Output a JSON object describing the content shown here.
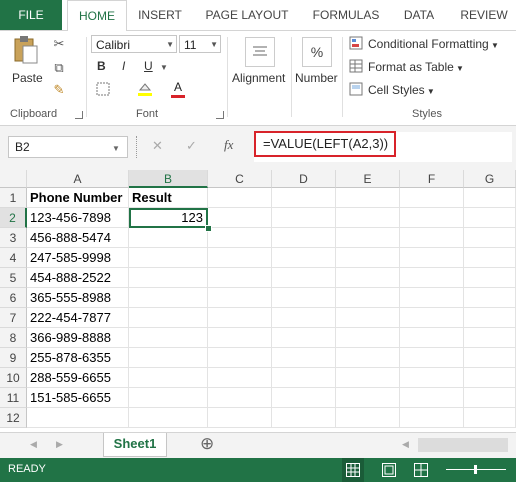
{
  "tabs": [
    "FILE",
    "HOME",
    "INSERT",
    "PAGE LAYOUT",
    "FORMULAS",
    "DATA",
    "REVIEW"
  ],
  "ribbon": {
    "clipboard": {
      "paste": "Paste",
      "label": "Clipboard"
    },
    "font": {
      "name": "Calibri",
      "size": "11",
      "bold": "B",
      "italic": "I",
      "underline": "U",
      "font_color_letter": "A",
      "label": "Font"
    },
    "alignment": {
      "label": "Alignment"
    },
    "number": {
      "label": "Number",
      "symbol": "%"
    },
    "styles": {
      "conditional": "Conditional Formatting",
      "format_table": "Format as Table",
      "cell_styles": "Cell Styles",
      "label": "Styles"
    }
  },
  "formula_bar": {
    "name_box": "B2",
    "fx": "fx",
    "cancel": "✕",
    "enter": "✓",
    "formula": "=VALUE(LEFT(A2,3))"
  },
  "grid": {
    "columns": [
      "A",
      "B",
      "C",
      "D",
      "E",
      "F",
      "G"
    ],
    "rows": [
      "1",
      "2",
      "3",
      "4",
      "5",
      "6",
      "7",
      "8",
      "9",
      "10",
      "11",
      "12"
    ],
    "colA": [
      "Phone Number",
      "123-456-7898",
      "456-888-5474",
      "247-585-9998",
      "454-888-2522",
      "365-555-8988",
      "222-454-7877",
      "366-989-8888",
      "255-878-6355",
      "288-559-6655",
      "151-585-6655",
      ""
    ],
    "colB": [
      "Result",
      "123",
      "",
      "",
      "",
      "",
      "",
      "",
      "",
      "",
      "",
      ""
    ]
  },
  "sheets": {
    "active": "Sheet1",
    "add": "⊕"
  },
  "status": {
    "text": "READY"
  },
  "colors": {
    "excel_green": "#217346",
    "highlight_red": "#d8232a"
  }
}
